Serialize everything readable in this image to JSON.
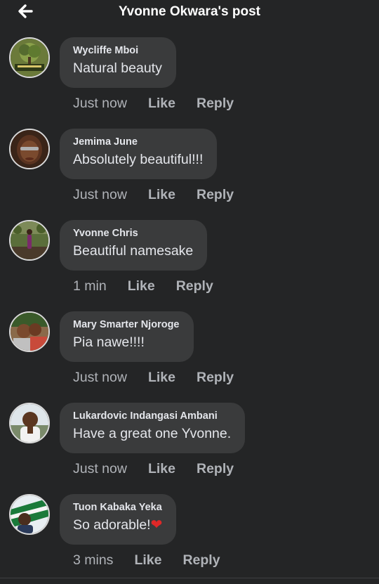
{
  "header": {
    "title": "Yvonne Okwara's post"
  },
  "comments": [
    {
      "author": "Wycliffe Mboi",
      "text": "Natural beauty",
      "time": "Just now",
      "like": "Like",
      "reply": "Reply"
    },
    {
      "author": "Jemima June",
      "text": "Absolutely beautiful!!!",
      "time": "Just now",
      "like": "Like",
      "reply": "Reply"
    },
    {
      "author": "Yvonne Chris",
      "text": "Beautiful namesake",
      "time": "1 min",
      "like": "Like",
      "reply": "Reply"
    },
    {
      "author": "Mary Smarter Njoroge",
      "text": "Pia nawe!!!!",
      "time": "Just now",
      "like": "Like",
      "reply": "Reply"
    },
    {
      "author": "Lukardovic Indangasi Ambani",
      "text": "Have a great one Yvonne.",
      "time": "Just now",
      "like": "Like",
      "reply": "Reply"
    },
    {
      "author": "Tuon Kabaka Yeka",
      "text": "So adorable!",
      "emoji": "heart-emoji",
      "time": "3 mins",
      "like": "Like",
      "reply": "Reply"
    }
  ],
  "icons": {
    "back": "arrow-left-icon"
  },
  "colors": {
    "background": "#242526",
    "bubble": "#3a3b3c",
    "text": "#e4e6eb",
    "muted": "#b0b3b8",
    "heart": "#e02828"
  }
}
